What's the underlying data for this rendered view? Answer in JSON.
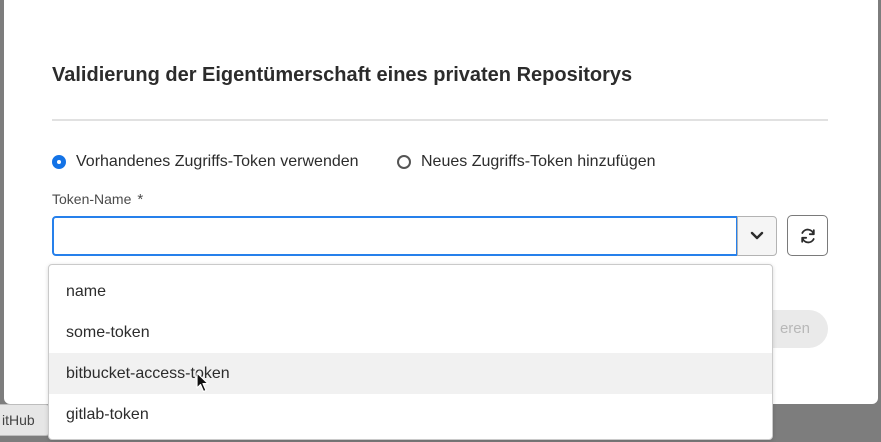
{
  "background": {
    "chip_label": "itHub"
  },
  "dialog": {
    "title": "Validierung der Eigentümerschaft eines privaten Repositorys",
    "options": {
      "existing_label": "Vorhandenes Zugriffs-Token verwenden",
      "new_label": "Neues Zugriffs-Token hinzufügen",
      "selected": "existing"
    },
    "field": {
      "label": "Token-Name",
      "required_marker": "*",
      "value": ""
    },
    "partial_button_label": "eren",
    "dropdown": {
      "items": [
        "name",
        "some-token",
        "bitbucket-access-token",
        "gitlab-token"
      ],
      "hovered_index": 2
    },
    "icons": {
      "combo_toggle": "chevron-down-icon",
      "refresh": "refresh-icon",
      "pointer": "mouse-cursor-icon"
    },
    "colors": {
      "accent": "#1473e6",
      "focus_border": "#2680eb",
      "text": "#2c2c2c"
    }
  }
}
